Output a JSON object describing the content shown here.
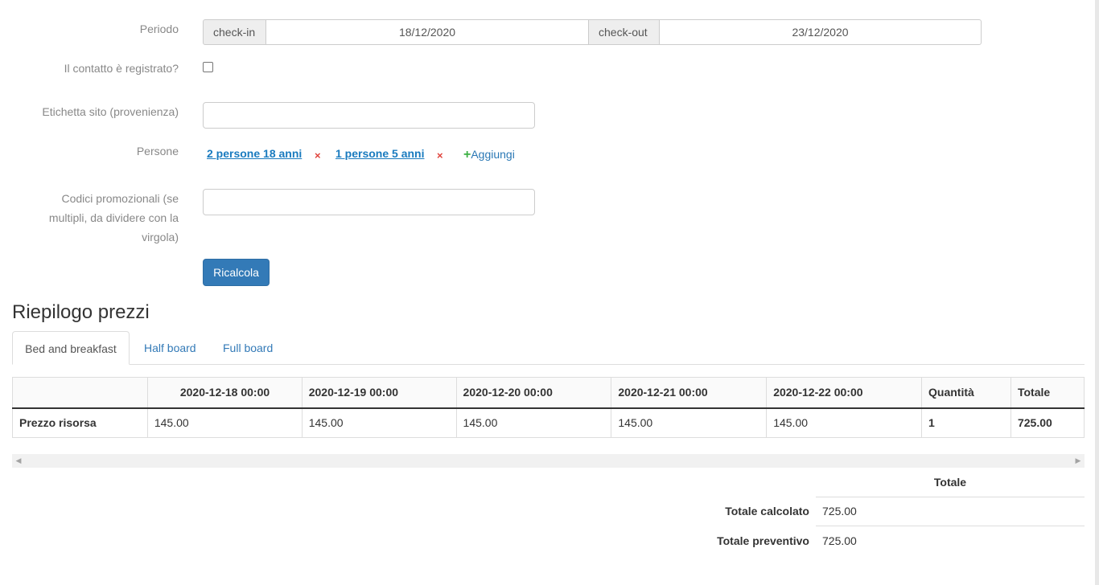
{
  "form": {
    "period_label": "Periodo",
    "checkin_label": "check-in",
    "checkin_value": "18/12/2020",
    "checkout_label": "check-out",
    "checkout_value": "23/12/2020",
    "registered_label": "Il contatto è registrato?",
    "site_label": "Etichetta sito (provenienza)",
    "site_value": "",
    "persons_label": "Persone",
    "persons": [
      {
        "label": "2 persone 18 anni",
        "remove": "×"
      },
      {
        "label": "1 persone 5 anni",
        "remove": "×"
      }
    ],
    "add_label": "Aggiungi",
    "add_icon": "+",
    "promo_label_lines": [
      "Codici promozionali (se",
      "multipli, da dividere con la",
      "virgola)"
    ],
    "promo_value": "",
    "recalc_button": "Ricalcola"
  },
  "summary": {
    "title": "Riepilogo prezzi",
    "tabs": [
      "Bed and breakfast",
      "Half board",
      "Full board"
    ],
    "table": {
      "headers": [
        "",
        "2020-12-18 00:00",
        "2020-12-19 00:00",
        "2020-12-20 00:00",
        "2020-12-21 00:00",
        "2020-12-22 00:00",
        "Quantità",
        "Totale"
      ],
      "row": [
        "Prezzo risorsa",
        "145.00",
        "145.00",
        "145.00",
        "145.00",
        "145.00",
        "1",
        "725.00"
      ]
    },
    "scroll_left_icon": "◀",
    "scroll_right_icon": "▶",
    "totals": {
      "header": "Totale",
      "calc_label": "Totale calcolato",
      "calc_value": "725.00",
      "quote_label": "Totale preventivo",
      "quote_value": "725.00"
    }
  },
  "colors": {
    "primary": "#337ab7",
    "link": "#1a7bbf",
    "remove": "#e0433c",
    "add": "#3cb043"
  }
}
